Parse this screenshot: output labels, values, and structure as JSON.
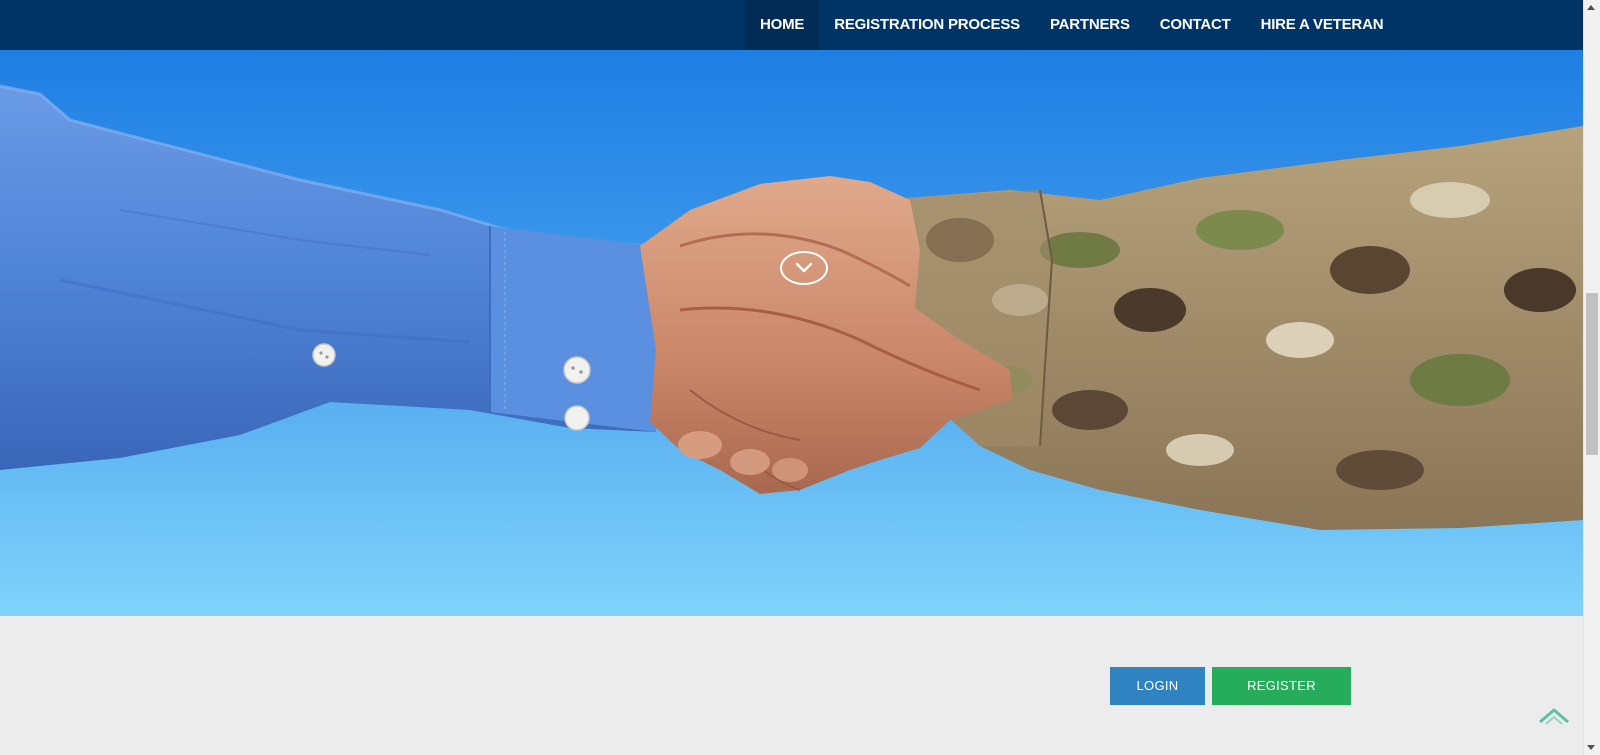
{
  "nav": {
    "items": [
      {
        "label": "HOME",
        "active": true
      },
      {
        "label": "REGISTRATION PROCESS",
        "active": false
      },
      {
        "label": "PARTNERS",
        "active": false
      },
      {
        "label": "CONTACT",
        "active": false
      },
      {
        "label": "HIRE A VETERAN",
        "active": false
      }
    ]
  },
  "hero": {
    "image": "handshake-shirt-sleeve-and-camouflage-uniform",
    "scroll_icon": "chevron-down-icon"
  },
  "actions": {
    "login_label": "LOGIN",
    "register_label": "REGISTER"
  },
  "back_to_top_icon": "chevron-up-icon",
  "colors": {
    "navbar": "#003466",
    "nav_active": "#022b55",
    "login": "#2f83c0",
    "register": "#26ad5c",
    "page_background": "#ececec",
    "back_to_top": "#5fc1a6"
  }
}
